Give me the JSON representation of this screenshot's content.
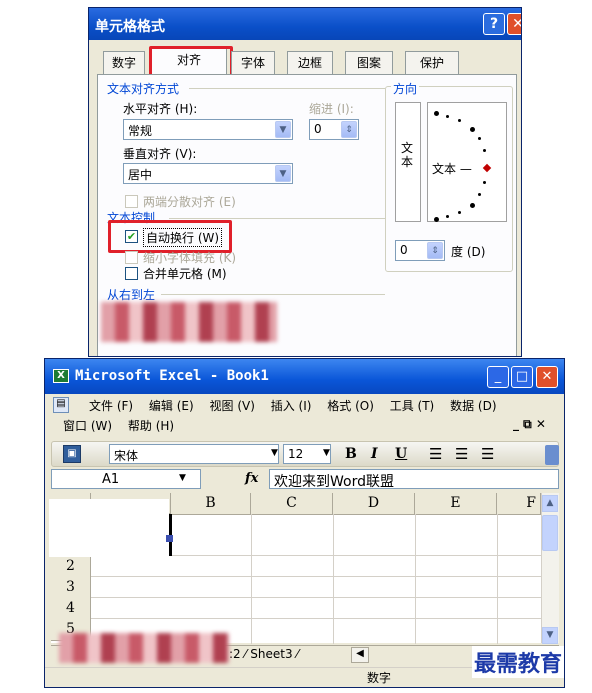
{
  "dialog": {
    "title": "单元格格式",
    "help_btn": "?",
    "close_btn": "✕",
    "tabs": [
      "数字",
      "对齐",
      "字体",
      "边框",
      "图案",
      "保护"
    ],
    "text_align_group": "文本对齐方式",
    "horizontal_label": "水平对齐 (H):",
    "horizontal_value": "常规",
    "indent_label": "缩进 (I):",
    "indent_value": "0",
    "vertical_label": "垂直对齐 (V):",
    "vertical_value": "居中",
    "distributed_label": "两端分散对齐 (E)",
    "text_control_group": "文本控制",
    "wrap_label": "自动换行 (W)",
    "shrink_label": "缩小字体填充 (K)",
    "merge_label": "合并单元格 (M)",
    "rtl_group": "从右到左",
    "orientation_group": "方向",
    "vertical_text": "文本",
    "orientation_text": "文本 —",
    "degree_value": "0",
    "degree_label": "度 (D)"
  },
  "excel": {
    "title": "Microsoft Excel - Book1",
    "menu_row1": [
      "文件 (F)",
      "编辑 (E)",
      "视图 (V)",
      "插入 (I)",
      "格式 (O)",
      "工具 (T)",
      "数据 (D)"
    ],
    "menu_row2": [
      "窗口 (W)",
      "帮助 (H)"
    ],
    "doc_controls": "_ ⧉ ✕",
    "font_name": "宋体",
    "font_size": "12",
    "bold": "B",
    "italic": "I",
    "underline": "U",
    "name_box": "A1",
    "fx": "fx",
    "formula": "欢迎来到Word联盟",
    "col_headers": [
      "B",
      "C",
      "D",
      "E",
      "F"
    ],
    "row_headers": [
      "2",
      "3",
      "4",
      "5"
    ],
    "sheet_tab": ":2 ⁄ Sheet3 ⁄",
    "status": "数字"
  },
  "watermark": "最需教育"
}
